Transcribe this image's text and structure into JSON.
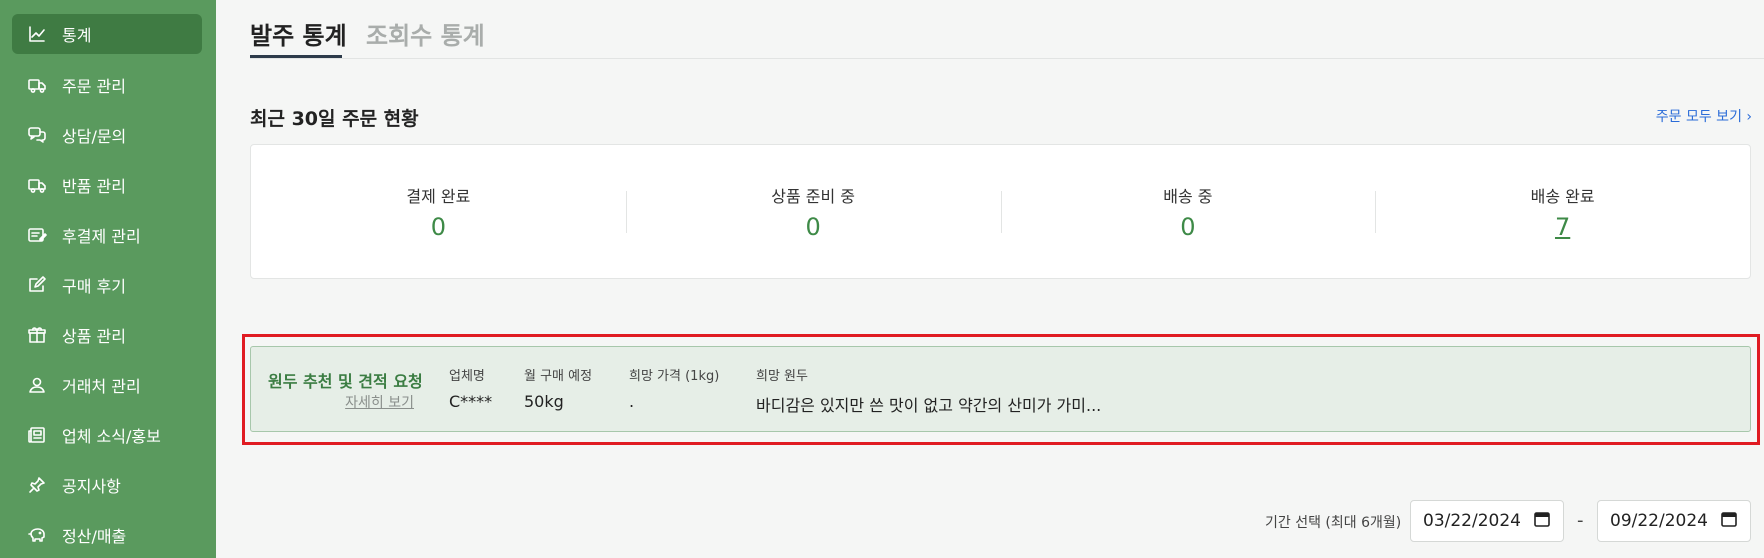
{
  "sidebar": {
    "items": [
      {
        "label": "통계",
        "icon": "chart-line-icon",
        "active": true
      },
      {
        "label": "주문 관리",
        "icon": "truck-icon"
      },
      {
        "label": "상담/문의",
        "icon": "chat-bubbles-icon"
      },
      {
        "label": "반품 관리",
        "icon": "truck-return-icon"
      },
      {
        "label": "후결제 관리",
        "icon": "edit-card-icon"
      },
      {
        "label": "구매 후기",
        "icon": "review-pen-icon"
      },
      {
        "label": "상품 관리",
        "icon": "box-icon"
      },
      {
        "label": "거래처 관리",
        "icon": "person-icon"
      },
      {
        "label": "업체 소식/홍보",
        "icon": "newspaper-icon"
      },
      {
        "label": "공지사항",
        "icon": "pin-icon"
      },
      {
        "label": "정산/매출",
        "icon": "piggy-bank-icon"
      }
    ]
  },
  "tabs": [
    {
      "label": "발주 통계",
      "active": true
    },
    {
      "label": "조회수 통계",
      "active": false
    }
  ],
  "orders": {
    "title": "최근 30일 주문 현황",
    "view_all": "주문 모두 보기 ›",
    "stats": [
      {
        "label": "결제 완료",
        "value": "0"
      },
      {
        "label": "상품 준비 중",
        "value": "0"
      },
      {
        "label": "배송 중",
        "value": "0"
      },
      {
        "label": "배송 완료",
        "value": "7"
      }
    ]
  },
  "request": {
    "title": "원두 추천 및 견적 요청",
    "more": "자세히 보기",
    "columns": [
      {
        "header": "업체명",
        "value": "C****"
      },
      {
        "header": "월 구매 예정",
        "value": "50kg"
      },
      {
        "header": "희망 가격 (1kg)",
        "value": "."
      },
      {
        "header": "희망 원두",
        "value": "바디감은 있지만 쓴 맛이 없고 약간의 산미가 가미..."
      }
    ]
  },
  "date_range": {
    "label": "기간 선택 (최대 6개월)",
    "start": "03/22/2024",
    "separator": "-",
    "end": "09/22/2024"
  },
  "colors": {
    "sidebar_bg": "#5a9a5e",
    "sidebar_active": "#3f7b43",
    "accent_green": "#3e8a47",
    "link_blue": "#2b6cd8",
    "highlight_red": "#e01b22"
  }
}
